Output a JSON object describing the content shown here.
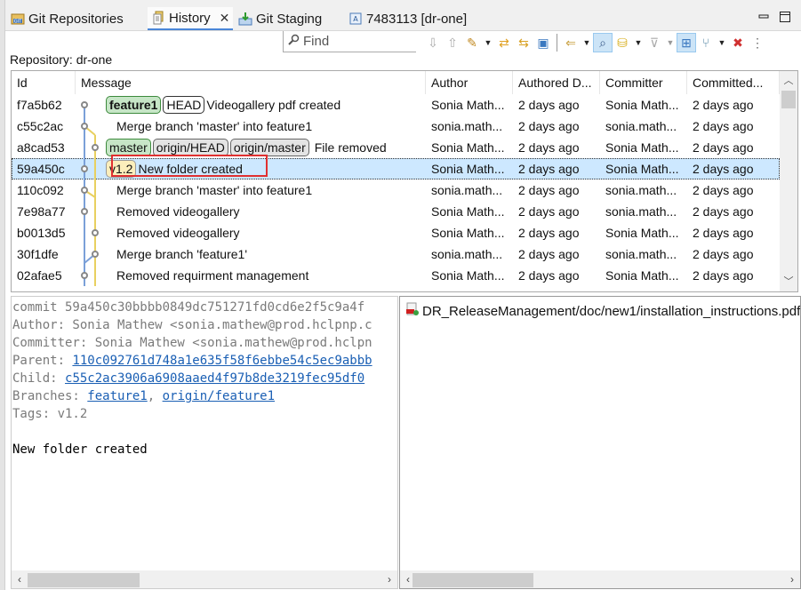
{
  "tabs": [
    {
      "label": "Git Repositories",
      "icon": "git-repositories-icon",
      "active": false
    },
    {
      "label": "History",
      "icon": "history-icon",
      "active": true,
      "closable": true
    },
    {
      "label": "Git Staging",
      "icon": "git-staging-icon",
      "active": false
    },
    {
      "label": "7483113 [dr-one]",
      "icon": "commit-editor-icon",
      "active": false
    }
  ],
  "window_controls": {
    "minimize": "minimize-icon",
    "maximize": "maximize-icon"
  },
  "find": {
    "placeholder": "Find"
  },
  "toolbar": [
    {
      "name": "next-highlighted-button",
      "icon": "arrow-down-icon",
      "glyph": "⇩"
    },
    {
      "name": "previous-highlighted-button",
      "icon": "arrow-up-icon",
      "glyph": "⇧"
    },
    {
      "name": "show-menu-button",
      "icon": "wand-icon",
      "glyph": "✎",
      "dropdown": true
    },
    {
      "name": "compare-mode-button",
      "icon": "sync-icon",
      "glyph": "⇄"
    },
    {
      "name": "link-with-selection-button",
      "icon": "link-icon",
      "glyph": "⇆"
    },
    {
      "name": "show-in-editor-button",
      "icon": "editor-icon",
      "glyph": "▣"
    },
    {
      "name": "switch-repository-button",
      "icon": "repository-icon",
      "glyph": "⇐",
      "dropdown": true
    },
    {
      "name": "find-toggle-button",
      "icon": "search-icon",
      "glyph": "⌕",
      "active": true
    },
    {
      "name": "database-button",
      "icon": "database-icon",
      "glyph": "⛁",
      "dropdown": true
    },
    {
      "name": "filter-button",
      "icon": "filter-icon",
      "glyph": "⊽",
      "dropdown": true
    },
    {
      "name": "layout-button",
      "icon": "layout-icon",
      "glyph": "⊞",
      "active": true
    },
    {
      "name": "show-branches-button",
      "icon": "branches-icon",
      "glyph": "⑂",
      "dropdown": true
    },
    {
      "name": "remove-filter-button",
      "icon": "remove-branch-icon",
      "glyph": "✖"
    },
    {
      "name": "view-menu-button",
      "icon": "more-vertical-icon",
      "glyph": "⋮"
    }
  ],
  "repository_label": "Repository: dr-one",
  "table": {
    "columns": [
      "Id",
      "Message",
      "Author",
      "Authored D...",
      "Committer",
      "Committed..."
    ],
    "rows": [
      {
        "id": "f7a5b62",
        "refs": [
          {
            "label": "feature1",
            "type": "branch-local bold"
          },
          {
            "label": "HEAD",
            "type": "head"
          }
        ],
        "message": "Videogallery pdf created",
        "author": "Sonia Math...",
        "authored": "2 days ago",
        "committer": "Sonia Math...",
        "committed": "2 days ago"
      },
      {
        "id": "c55c2ac",
        "refs": [],
        "message": "Merge branch 'master' into feature1",
        "author": "sonia.math...",
        "authored": "2 days ago",
        "committer": "sonia.math...",
        "committed": "2 days ago"
      },
      {
        "id": "a8cad53",
        "refs": [
          {
            "label": "master",
            "type": "branch-local"
          },
          {
            "label": "origin/HEAD",
            "type": "remote"
          },
          {
            "label": "origin/master",
            "type": "remote"
          }
        ],
        "message": "File removed",
        "author": "Sonia Math...",
        "authored": "2 days ago",
        "committer": "Sonia Math...",
        "committed": "2 days ago"
      },
      {
        "id": "59a450c",
        "refs": [
          {
            "label": "v1.2",
            "type": "tag"
          }
        ],
        "message": "New folder created",
        "author": "Sonia Math...",
        "authored": "2 days ago",
        "committer": "Sonia Math...",
        "committed": "2 days ago",
        "selected": true
      },
      {
        "id": "110c092",
        "refs": [],
        "message": "Merge branch 'master' into feature1",
        "author": "sonia.math...",
        "authored": "2 days ago",
        "committer": "sonia.math...",
        "committed": "2 days ago"
      },
      {
        "id": "7e98a77",
        "refs": [],
        "message": "Removed videogallery",
        "author": "Sonia Math...",
        "authored": "2 days ago",
        "committer": "sonia.math...",
        "committed": "2 days ago"
      },
      {
        "id": "b0013d5",
        "refs": [],
        "message": "Removed videogallery",
        "author": "Sonia Math...",
        "authored": "2 days ago",
        "committer": "Sonia Math...",
        "committed": "2 days ago"
      },
      {
        "id": "30f1dfe",
        "refs": [],
        "message": "Merge branch 'feature1'",
        "author": "sonia.math...",
        "authored": "2 days ago",
        "committer": "sonia.math...",
        "committed": "2 days ago"
      },
      {
        "id": "02afae5",
        "refs": [],
        "message": "Removed requirment management",
        "author": "Sonia Math...",
        "authored": "2 days ago",
        "committer": "Sonia Math...",
        "committed": "2 days ago"
      }
    ]
  },
  "graph_colors": {
    "lane1": "#7ba0d8",
    "lane2": "#e8d060",
    "node": "#888888"
  },
  "details": {
    "commit_line": "commit 59a450c30bbbb0849dc751271fd0cd6e2f5c9a4f",
    "author_line": "Author: Sonia Mathew <sonia.mathew@prod.hclpnp.c",
    "committer_line": "Committer: Sonia Mathew <sonia.mathew@prod.hclpn",
    "parent_label": "Parent: ",
    "parent_hash": "110c092761d748a1e635f58f6ebbe54c5ec9abbb",
    "child_label": "Child: ",
    "child_hash": "c55c2ac3906a6908aaed4f97b8de3219fec95df0",
    "branches_label": "Branches: ",
    "branch1": "feature1",
    "branch_sep": ", ",
    "branch2": "origin/feature1",
    "tags_line": "Tags: v1.2",
    "message": "New folder created"
  },
  "files": [
    {
      "path": "DR_ReleaseManagement/doc/new1/installation_instructions.pdf",
      "icon": "pdf-file-added-icon"
    }
  ],
  "colors": {
    "selection": "#cde8ff",
    "accent": "#4a86d8",
    "highlight_box": "#e03030",
    "link": "#1a5fb4"
  }
}
